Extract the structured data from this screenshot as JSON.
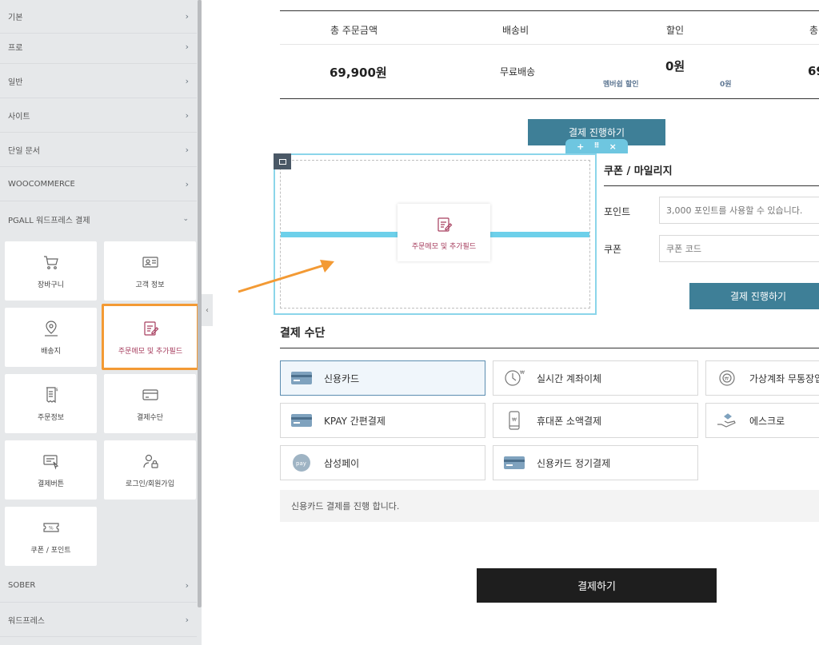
{
  "sidebar": {
    "categories_top": [
      {
        "label": "기본"
      },
      {
        "label": "프로"
      },
      {
        "label": "일반"
      },
      {
        "label": "사이트"
      },
      {
        "label": "단일 문서"
      },
      {
        "label": "WOOCOMMERCE"
      }
    ],
    "expanded_category": {
      "label": "PGALL 워드프레스 결제",
      "chevron": "chevron-down-icon"
    },
    "widgets": [
      {
        "label": "장바구니",
        "icon": "cart-icon"
      },
      {
        "label": "고객 정보",
        "icon": "id-card-icon"
      },
      {
        "label": "배송지",
        "icon": "map-pin-icon"
      },
      {
        "label": "주문메모 및 추가필드",
        "icon": "memo-edit-icon",
        "active": true
      },
      {
        "label": "주문정보",
        "icon": "receipt-icon"
      },
      {
        "label": "결제수단",
        "icon": "credit-card-icon"
      },
      {
        "label": "결제버튼",
        "icon": "pay-button-icon"
      },
      {
        "label": "로그인/회원가입",
        "icon": "user-lock-icon"
      },
      {
        "label": "쿠폰 / 포인트",
        "icon": "coupon-icon"
      }
    ],
    "categories_bottom": [
      {
        "label": "SOBER"
      },
      {
        "label": "워드프레스"
      }
    ]
  },
  "summary": {
    "headers": [
      "총 주문금액",
      "배송비",
      "할인",
      "총"
    ],
    "total_amount": "69,900원",
    "shipping": "무료배송",
    "discount": "0원",
    "membership_discount_label": "멤버쉽 할인",
    "membership_discount_value": "0원",
    "grand_total_partial": "69"
  },
  "proceed_button_top": "결제 진행하기",
  "dragged_widget_label": "주문메모 및 추가필드",
  "coupon_section": {
    "title": "쿠폰 / 마일리지",
    "point_label": "포인트",
    "point_placeholder": "3,000 포인트를 사용할 수 있습니다.",
    "coupon_label": "쿠폰",
    "coupon_placeholder": "쿠폰 코드",
    "proceed_button": "결제 진행하기"
  },
  "payment": {
    "title": "결제 수단",
    "methods": [
      {
        "label": "신용카드",
        "icon": "credit-card-icon",
        "selected": true
      },
      {
        "label": "실시간 계좌이체",
        "icon": "realtime-transfer-icon"
      },
      {
        "label": "가상계좌 무통장입",
        "icon": "virtual-account-icon"
      },
      {
        "label": "KPAY 간편결제",
        "icon": "kpay-card-icon"
      },
      {
        "label": "휴대폰 소액결제",
        "icon": "mobile-phone-icon"
      },
      {
        "label": "에스크로",
        "icon": "escrow-hand-icon"
      },
      {
        "label": "삼성페이",
        "icon": "samsung-pay-icon"
      },
      {
        "label": "신용카드 정기결제",
        "icon": "subscription-card-icon"
      }
    ],
    "description": "신용카드 결제를 진행 합니다."
  },
  "pay_button": "결제하기",
  "colors": {
    "accent_orange": "#f39a34",
    "teal_button": "#3e7f97",
    "section_outline": "#8bd5ea",
    "memo_label": "#a63d5e",
    "membership_text": "#5f7894"
  }
}
